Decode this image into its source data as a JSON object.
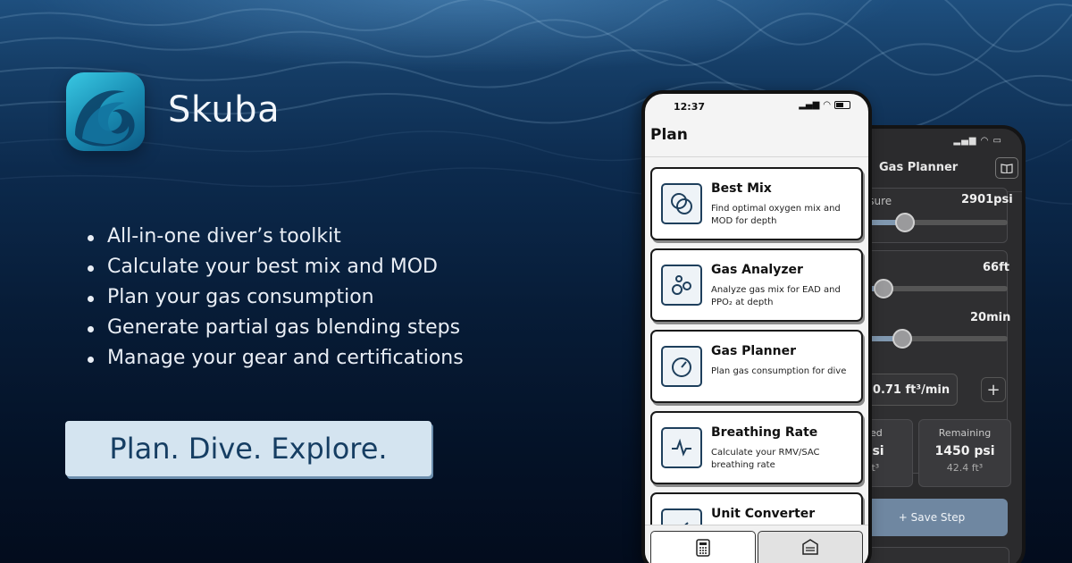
{
  "brand": {
    "app_name": "Skuba"
  },
  "features": [
    "All-in-one diver’s toolkit",
    "Calculate your best mix and MOD",
    "Plan your gas consumption",
    "Generate partial gas blending steps",
    "Manage your gear and certifications"
  ],
  "cta": {
    "label": "Plan. Dive. Explore."
  },
  "phone_front": {
    "time": "12:37",
    "title": "Plan",
    "tools": [
      {
        "name": "Best Mix",
        "description": "Find optimal oxygen mix and MOD for depth",
        "icon": "overlapping-circles-icon"
      },
      {
        "name": "Gas Analyzer",
        "description": "Analyze gas mix for EAD and PPO₂ at depth",
        "icon": "bubbles-icon"
      },
      {
        "name": "Gas Planner",
        "description": "Plan gas consumption for dive",
        "icon": "gauge-icon"
      },
      {
        "name": "Breathing Rate",
        "description": "Calculate your RMV/SAC breathing rate",
        "icon": "pulse-icon"
      },
      {
        "name": "Unit Converter",
        "description": "",
        "icon": "convert-icon"
      }
    ],
    "tabs": [
      {
        "icon": "calculator-icon",
        "selected": true
      },
      {
        "icon": "garage-icon",
        "selected": false
      }
    ]
  },
  "phone_back": {
    "title": "Gas Planner",
    "pressure_label": "ssure",
    "pressure_value": "2901psi",
    "pressure_level": 0.3,
    "depth_value": "66ft",
    "depth_level": 0.15,
    "time_value": "20min",
    "time_level": 0.28,
    "rmv_value": "0.71  ft³/min",
    "plus_label": "+",
    "used": {
      "label": "sed",
      "big": "psi",
      "small": "ft³"
    },
    "remaining": {
      "label": "Remaining",
      "big": "1450 psi",
      "small": "42.4 ft³"
    },
    "save_label": "+ Save Step"
  },
  "colors": {
    "cta_bg": "#d4e4f0",
    "cta_text": "#163e63",
    "icon_accent": "#1e3f5c",
    "logo_gradient_start": "#39c8e3",
    "save_button": "#6f87a1"
  }
}
